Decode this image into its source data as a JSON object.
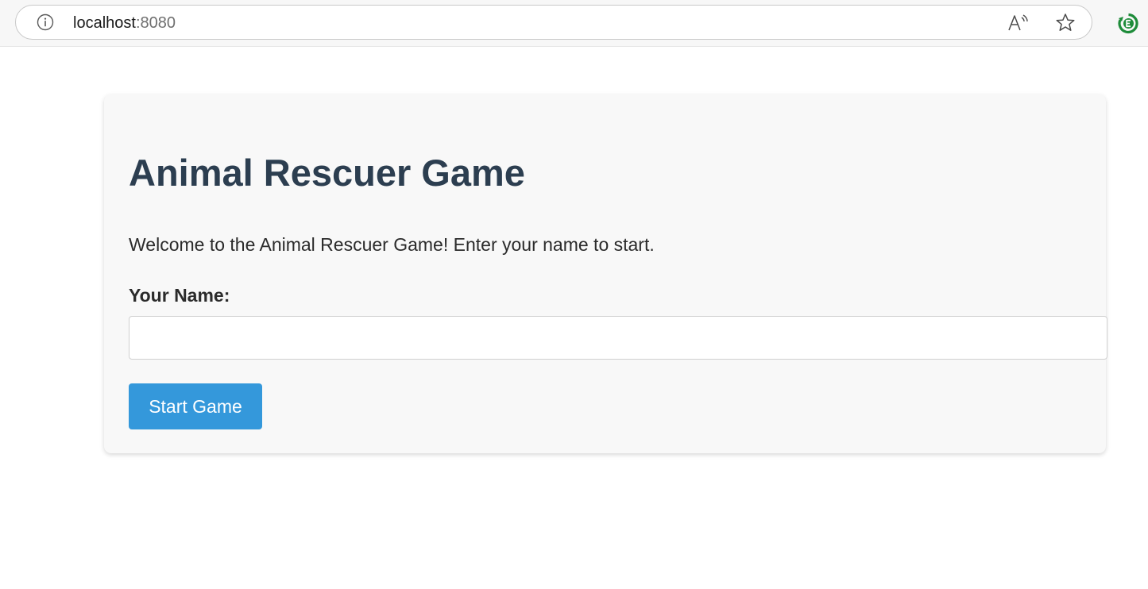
{
  "browser": {
    "url_host": "localhost",
    "url_port": ":8080",
    "icons": {
      "info": "info-icon",
      "read_aloud": "read-aloud-icon",
      "favorite": "star-icon",
      "extension": "extension-icon"
    }
  },
  "page": {
    "title": "Animal Rescuer Game",
    "welcome_text": "Welcome to the Animal Rescuer Game! Enter your name to start.",
    "name_label": "Your Name:",
    "name_value": "",
    "start_button_label": "Start Game"
  },
  "colors": {
    "title": "#2c3e50",
    "button": "#3498db",
    "card_background": "#f8f8f8"
  }
}
